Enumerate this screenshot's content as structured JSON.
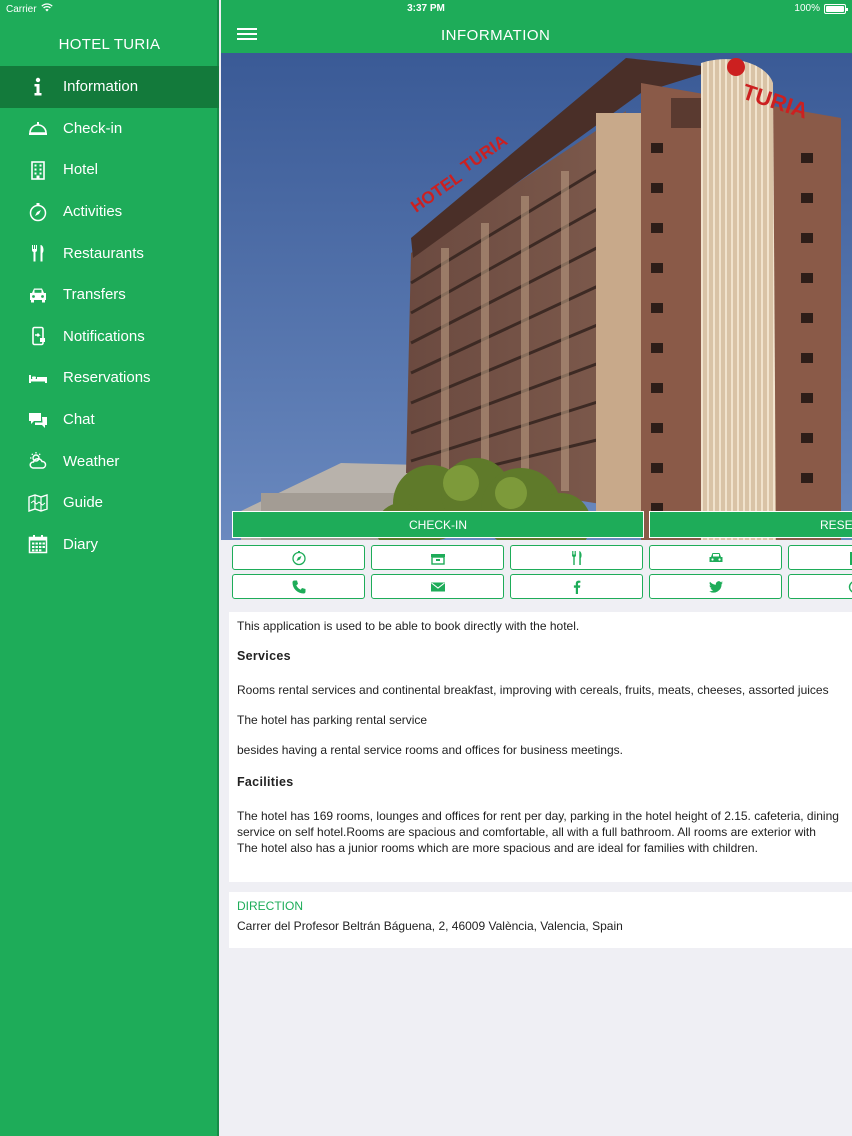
{
  "status_bar": {
    "carrier": "Carrier",
    "time": "3:37 PM",
    "battery": "100%"
  },
  "sidebar": {
    "title": "HOTEL TURIA",
    "items": [
      {
        "label": "Information",
        "icon": "info-icon",
        "active": true
      },
      {
        "label": "Check-in",
        "icon": "bell-icon"
      },
      {
        "label": "Hotel",
        "icon": "building-icon"
      },
      {
        "label": "Activities",
        "icon": "compass-icon"
      },
      {
        "label": "Restaurants",
        "icon": "cutlery-icon"
      },
      {
        "label": "Transfers",
        "icon": "car-icon"
      },
      {
        "label": "Notifications",
        "icon": "phone-notification-icon"
      },
      {
        "label": "Reservations",
        "icon": "bed-icon"
      },
      {
        "label": "Chat",
        "icon": "chat-icon"
      },
      {
        "label": "Weather",
        "icon": "weather-icon"
      },
      {
        "label": "Guide",
        "icon": "map-icon"
      },
      {
        "label": "Diary",
        "icon": "calendar-icon"
      }
    ]
  },
  "header": {
    "title": "INFORMATION"
  },
  "hero": {
    "sign": "TURIA"
  },
  "actions": {
    "checkin_label": "CHECK-IN",
    "reserve_label": "RESERVE"
  },
  "icon_buttons": [
    "compass-icon",
    "bell-icon",
    "cutlery-icon",
    "car-icon",
    "building-icon",
    "phone-icon",
    "mail-icon",
    "facebook-icon",
    "twitter-icon",
    "web-icon"
  ],
  "content": {
    "intro": "This application is used to be able to book directly with the hotel.",
    "services_heading": "Services",
    "services_1": "Rooms rental services and continental breakfast, improving with cereals, fruits, meats, cheeses, assorted juices",
    "services_2": "The hotel has parking rental service",
    "services_3": "besides having a rental service rooms and offices for business meetings.",
    "facilities_heading": "Facilities",
    "facilities_1": "The hotel has 169 rooms, lounges and offices for rent per day, parking in the hotel height of 2.15. cafeteria, dining",
    "facilities_2": "service on self hotel.Rooms are spacious and comfortable, all with a full bathroom. All rooms are exterior with",
    "facilities_3": "The hotel also has a junior rooms which are more spacious and are ideal for families with children."
  },
  "direction": {
    "label": "DIRECTION",
    "address": "Carrer del Profesor Beltrán Báguena, 2, 46009 València, Valencia, Spain"
  },
  "colors": {
    "brand": "#1eac59",
    "brand_dark": "#137a3b",
    "background": "#efeff4"
  }
}
